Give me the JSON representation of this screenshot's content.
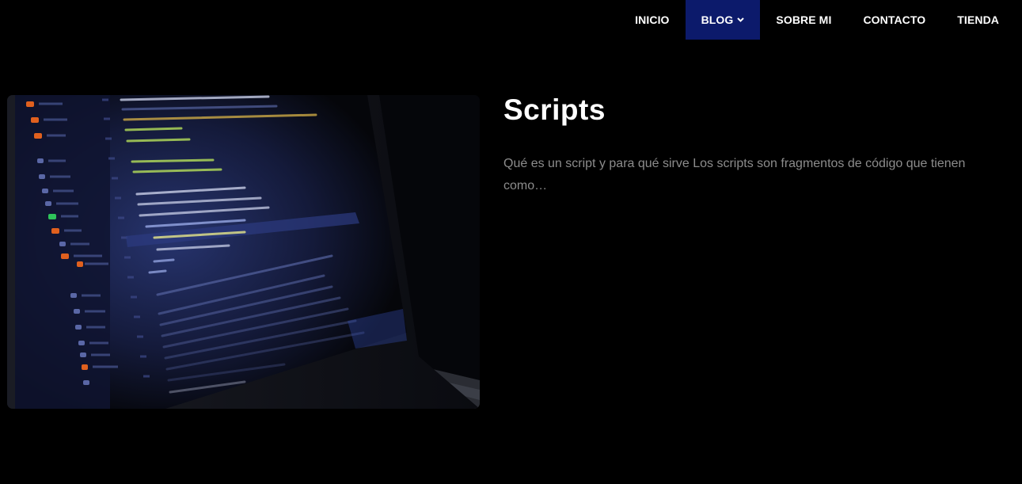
{
  "nav": {
    "items": [
      {
        "label": "INICIO"
      },
      {
        "label": "BLOG",
        "active": true
      },
      {
        "label": "SOBRE MI"
      },
      {
        "label": "CONTACTO"
      },
      {
        "label": "TIENDA"
      }
    ]
  },
  "post": {
    "title": "Scripts",
    "excerpt": "Qué es un script y para qué sirve Los scripts son fragmentos de código que tienen como…",
    "image_icon": "laptop-code-photo"
  },
  "colors": {
    "background": "#000000",
    "nav_active": "#0c1a6b",
    "excerpt_text": "#8c8c8c"
  }
}
